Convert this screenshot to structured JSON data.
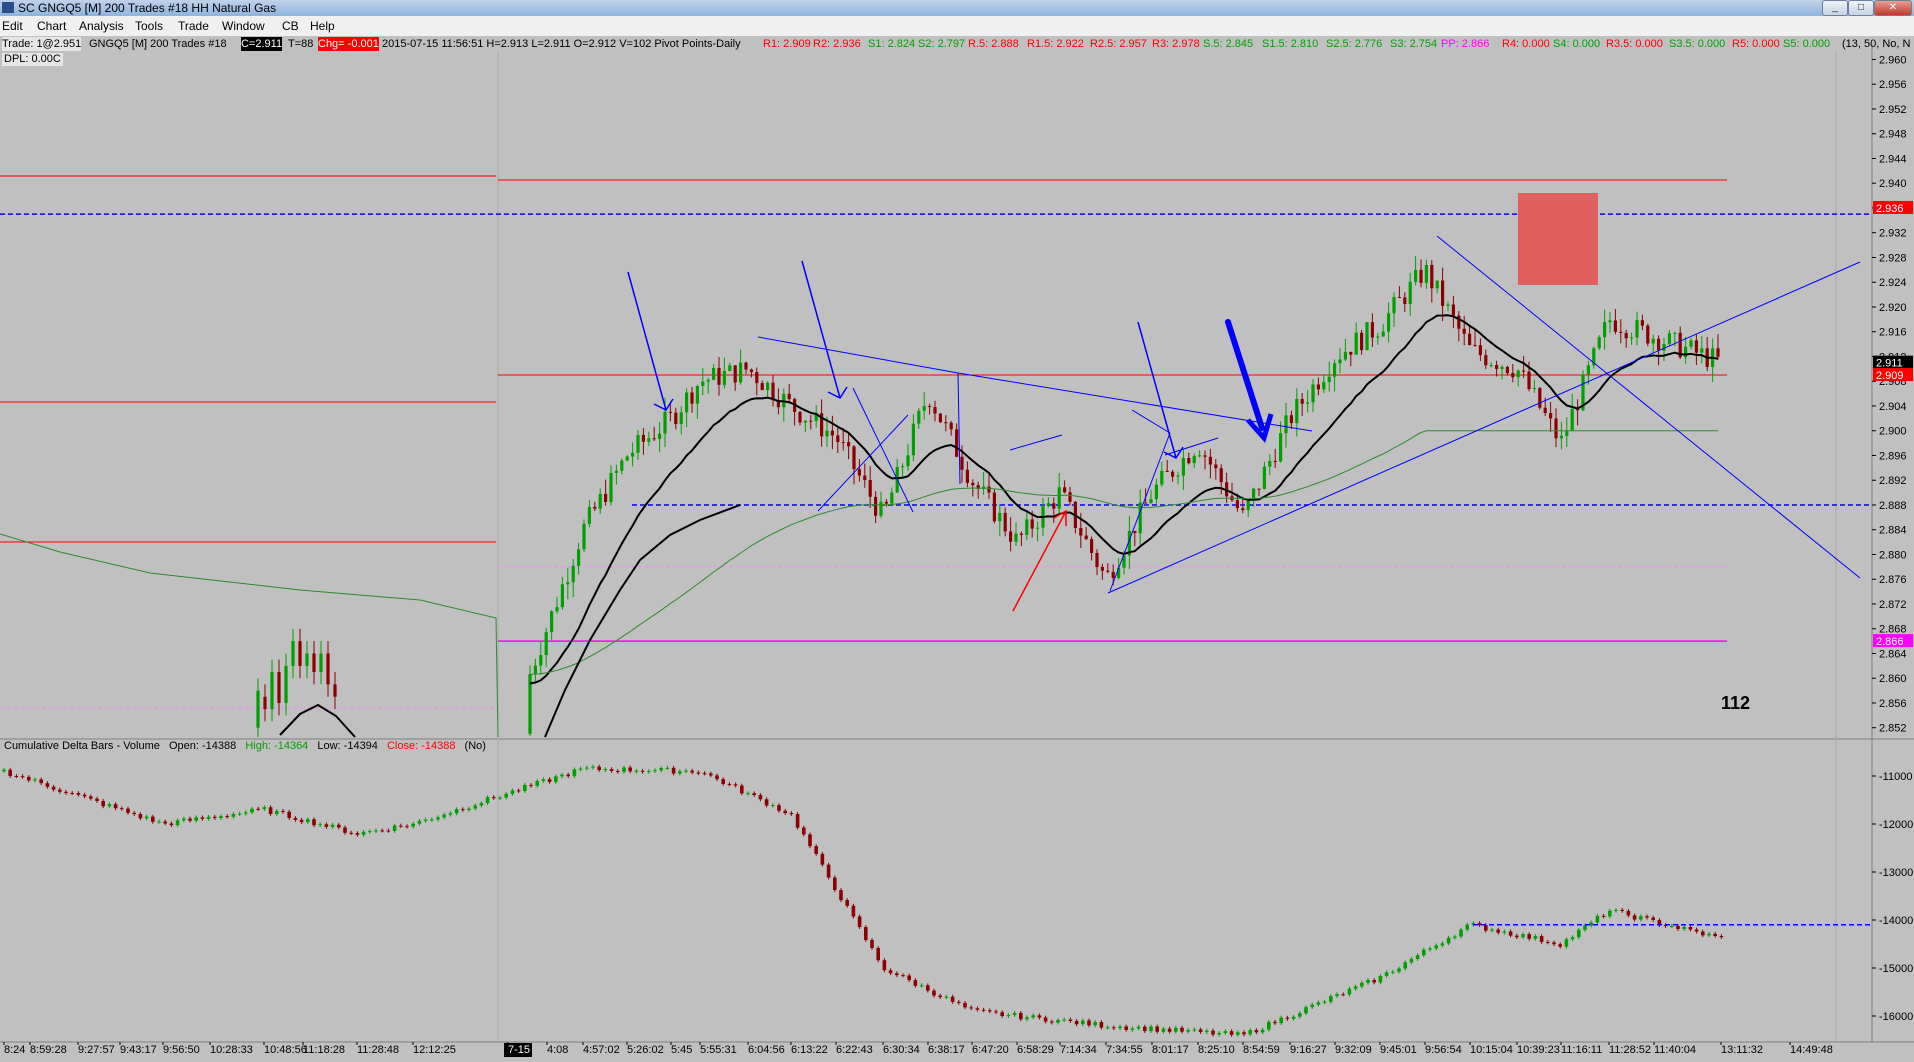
{
  "window": {
    "title": "SC GNGQ5 [M]  200 Trades  #18  HH Natural Gas",
    "buttons": [
      "_",
      "□",
      "✕"
    ]
  },
  "menu": [
    "Edit",
    "Chart",
    "Analysis",
    "Tools",
    "Trade",
    "Window",
    "CB",
    "Help"
  ],
  "status": {
    "trade": "Trade: 1@2.951",
    "symbol": "GNGQ5 [M]  200 Trades  #18",
    "close": "C=2.911",
    "t": "T=88",
    "chg": "Chg= -0.001",
    "stats": "2015-07-15  11:56:51  H=2.913  L=2.911  O=2.912  V=102  Pivot Points-Daily",
    "pivots_red": [
      "R1: 2.909",
      "R2: 2.936",
      "R.5: 2.888",
      "R1.5: 2.922",
      "R2.5: 2.957",
      "R3: 2.978"
    ],
    "pivots_green1": [
      "S1: 2.824",
      "S2: 2.797"
    ],
    "pivots_green2": [
      "S.5: 2.845",
      "S1.5: 2.810",
      "S2.5: 2.776",
      "S3: 2.754"
    ],
    "pp": "PP: 2.866",
    "pivots_red2": [
      "R4: 0.000",
      "R3.5: 0.000"
    ],
    "s4": "S4: 0.000",
    "s35": "S3.5: 0.000",
    "r5": "R5: 0.000",
    "s5": "S5: 0.000",
    "extra": "(13, 50, No, N"
  },
  "dpl": "DPL: 0.00C",
  "price_pane": {
    "y_ticks": [
      "2.960",
      "2.956",
      "2.952",
      "2.948",
      "2.944",
      "2.940",
      "2.936",
      "2.932",
      "2.928",
      "2.924",
      "2.920",
      "2.916",
      "2.912",
      "2.908",
      "2.904",
      "2.900",
      "2.896",
      "2.892",
      "2.888",
      "2.884",
      "2.880",
      "2.876",
      "2.872",
      "2.868",
      "2.864",
      "2.860",
      "2.856",
      "2.852"
    ],
    "y_range": [
      2.8505,
      2.9625
    ],
    "price_labels": [
      {
        "text": "2.936",
        "value": 2.936,
        "color": "#ff0000"
      },
      {
        "text": "2.911",
        "value": 2.911,
        "color": "#000000"
      },
      {
        "text": "2.909",
        "value": 2.909,
        "color": "#ff0000"
      },
      {
        "text": "2.866",
        "value": 2.866,
        "color": "#ff00ff"
      }
    ],
    "annotation_number": "112",
    "levels": {
      "r2": 2.936,
      "r1": 2.909,
      "r05": 2.888,
      "pp": 2.866,
      "pink_dash": 2.878,
      "blue_dash_top": 2.935,
      "blue_dash_mid": 2.888
    }
  },
  "delta_pane": {
    "title": "Cumulative Delta Bars - Volume",
    "open": "Open: -14388",
    "high": "High: -14364",
    "low": "Low: -14394",
    "close": "Close: -14388",
    "no": "(No)",
    "y_ticks": [
      "-11000",
      "-12000",
      "-13000",
      "-14000",
      "-15000",
      "-16000"
    ],
    "y_range": [
      -16500,
      -10500
    ],
    "dash_level": -14100
  },
  "time_axis": {
    "labels": [
      "8:24",
      "8:59:28",
      "9:27:57",
      "9:43:17",
      "9:56:50",
      "10:28:33",
      "10:48:56",
      "11:18:28",
      "11:28:48",
      "12:12:25",
      "7-15",
      "4:08",
      "4:57:02",
      "5:26:02",
      "5:45",
      "5:55:31",
      "6:04:56",
      "6:13:22",
      "6:22:43",
      "6:30:34",
      "6:38:17",
      "6:47:20",
      "6:58:29",
      "7:14:34",
      "7:34:55",
      "8:01:17",
      "8:25:10",
      "8:54:59",
      "9:16:27",
      "9:32:09",
      "9:45:01",
      "9:56:54",
      "10:15:04",
      "10:39:23",
      "11:16:11",
      "11:28:52",
      "11:40:04",
      "13:11:32",
      "14:49:48"
    ],
    "highlight": "7-15"
  },
  "colors": {
    "bg": "#c0c0c0",
    "up": "#00a000",
    "down": "#8b0000",
    "pivot_red": "#ff0000",
    "pp": "#ff00ff",
    "draw_blue": "#0000ff"
  },
  "chart_data": {
    "type": "candlestick",
    "symbol": "GNGQ5",
    "price_series_key_points": [
      [
        "4:08",
        2.851
      ],
      [
        "4:57:02",
        2.884
      ],
      [
        "5:26:02",
        2.896
      ],
      [
        "5:45",
        2.902
      ],
      [
        "5:55:31",
        2.908
      ],
      [
        "6:04:56",
        2.91
      ],
      [
        "6:13:22",
        2.904
      ],
      [
        "6:22:43",
        2.899
      ],
      [
        "6:30:34",
        2.886
      ],
      [
        "6:38:17",
        2.906
      ],
      [
        "6:47:20",
        2.892
      ],
      [
        "6:58:29",
        2.882
      ],
      [
        "7:14:34",
        2.89
      ],
      [
        "7:34:55",
        2.876
      ],
      [
        "8:01:17",
        2.89
      ],
      [
        "8:25:10",
        2.898
      ],
      [
        "8:54:59",
        2.886
      ],
      [
        "9:16:27",
        2.902
      ],
      [
        "9:32:09",
        2.912
      ],
      [
        "9:45:01",
        2.917
      ],
      [
        "9:56:54",
        2.926
      ],
      [
        "10:15:04",
        2.913
      ],
      [
        "10:39:23",
        2.91
      ],
      [
        "11:16:11",
        2.898
      ],
      [
        "11:28:52",
        2.918
      ],
      [
        "11:40:04",
        2.911
      ]
    ],
    "delta_key_points": [
      [
        "8:24",
        -10900
      ],
      [
        "9:43:17",
        -12000
      ],
      [
        "10:48:56",
        -11700
      ],
      [
        "11:28:48",
        -12200
      ],
      [
        "12:12:25",
        -12000
      ],
      [
        "4:57:02",
        -10850
      ],
      [
        "5:55:31",
        -10900
      ],
      [
        "6:13:22",
        -11800
      ],
      [
        "6:30:34",
        -15000
      ],
      [
        "6:47:20",
        -15900
      ],
      [
        "7:34:55",
        -16200
      ],
      [
        "8:54:59",
        -16400
      ],
      [
        "9:45:01",
        -15200
      ],
      [
        "10:15:04",
        -14100
      ],
      [
        "11:16:11",
        -14500
      ],
      [
        "11:28:52",
        -13800
      ],
      [
        "11:40:04",
        -14388
      ]
    ]
  }
}
